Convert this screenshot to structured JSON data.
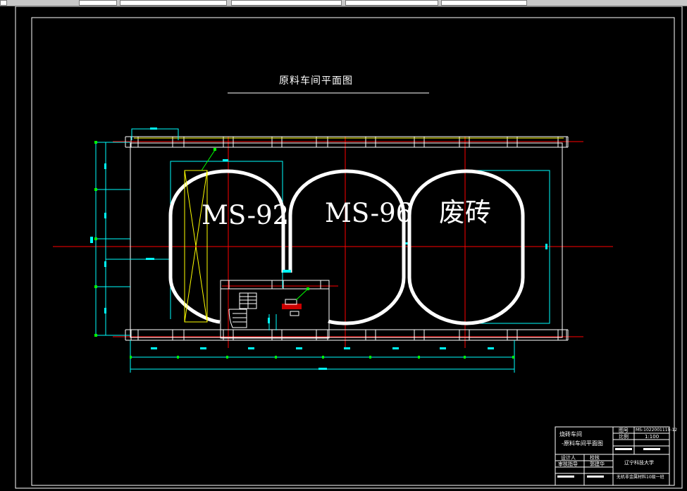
{
  "toolbar": {
    "cells": [
      "",
      "",
      "",
      "",
      "",
      ""
    ]
  },
  "drawing": {
    "title": "原料车间平面图",
    "areas": [
      {
        "id": "ms92",
        "label": "MS-92"
      },
      {
        "id": "ms96",
        "label": "MS-96"
      },
      {
        "id": "waste",
        "label": "废砖"
      }
    ]
  },
  "title_block": {
    "project_line1": "烧砖车间",
    "project_line2": "-原料车间平面图",
    "drawing_no_label": "图号",
    "drawing_no": "MS-1022001119-12",
    "scale_label": "比例",
    "scale": "1:100",
    "designer_label": "设计人",
    "check_label": "校核",
    "reviewer_label": "审核指导",
    "reviewer_name": "郭建华",
    "school": "辽宁科技大学",
    "bottom_line": "无机非金属材料10级一班"
  },
  "colors": {
    "background": "#000000",
    "red": "#ff0000",
    "cyan": "#00ffff",
    "yellow": "#ffff00",
    "green": "#00ff00",
    "white": "#ffffff"
  }
}
